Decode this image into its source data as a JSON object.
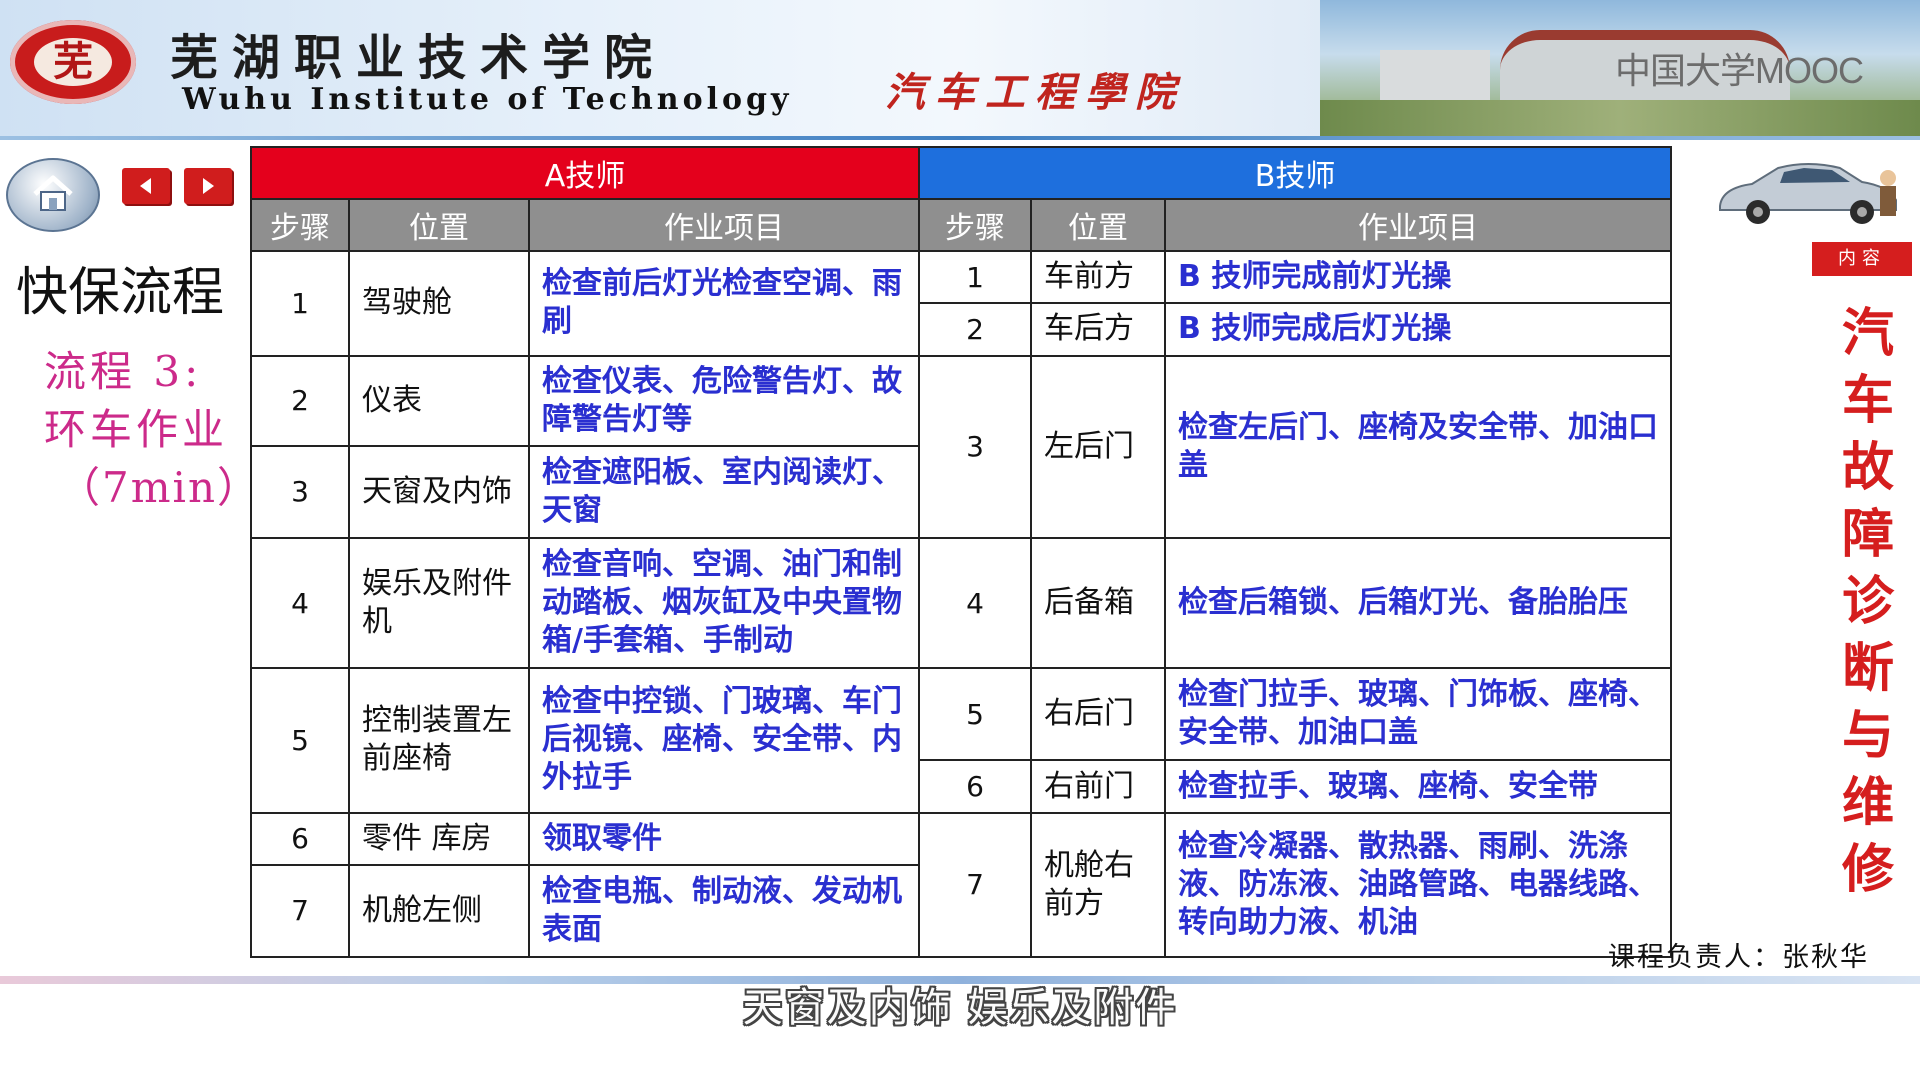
{
  "header": {
    "logo_text": "芜",
    "school_name_cn": "芜湖职业技术学院",
    "school_name_en": "Wuhu Institute of Technology",
    "college_name": "汽车工程學院",
    "watermark": "中国大学MOOC"
  },
  "left": {
    "title": "快保流程",
    "subtitle_line1": "流程 3:",
    "subtitle_line2": "环车作业",
    "subtitle_line3": "（7min）"
  },
  "table": {
    "header_a": "A技师",
    "header_b": "B技师",
    "col_step": "步骤",
    "col_position": "位置",
    "col_task": "作业项目",
    "a_rows": [
      {
        "step": "1",
        "position": "驾驶舱",
        "task": "检查前后灯光检查空调、雨刷"
      },
      {
        "step": "2",
        "position": "仪表",
        "task": "检查仪表、危险警告灯、故障警告灯等"
      },
      {
        "step": "3",
        "position": "天窗及内饰",
        "task": "检查遮阳板、室内阅读灯、天窗"
      },
      {
        "step": "4",
        "position": "娱乐及附件机",
        "task": "检查音响、空调、油门和制动踏板、烟灰缸及中央置物箱/手套箱、手制动"
      },
      {
        "step": "5",
        "position": "控制装置左前座椅",
        "task": "检查中控锁、门玻璃、车门后视镜、座椅、安全带、内外拉手"
      },
      {
        "step": "6",
        "position": "零件 库房",
        "task": "领取零件"
      },
      {
        "step": "7",
        "position": "机舱左侧",
        "task": "检查电瓶、制动液、发动机表面"
      }
    ],
    "b_rows": [
      {
        "step": "1",
        "position": "车前方",
        "task": "B 技师完成前灯光操"
      },
      {
        "step": "2",
        "position": "车后方",
        "task": "B 技师完成后灯光操"
      },
      {
        "step": "3",
        "position": "左后门",
        "task": "检查左后门、座椅及安全带、加油口盖"
      },
      {
        "step": "4",
        "position": "后备箱",
        "task": "检查后箱锁、后箱灯光、备胎胎压"
      },
      {
        "step": "5",
        "position": "右后门",
        "task": "检查门拉手、玻璃、门饰板、座椅、安全带、加油口盖"
      },
      {
        "step": "6",
        "position": "右前门",
        "task": "检查拉手、玻璃、座椅、安全带"
      },
      {
        "step": "7",
        "position": "机舱右前方",
        "task": "检查冷凝器、散热器、雨刷、洗涤液、防冻液、油路管路、电器线路、转向助力液、机油"
      }
    ]
  },
  "right": {
    "badge": "内容",
    "course_title": "汽车故障诊断与维修",
    "teacher": "课程负责人：张秋华"
  },
  "caption": "天窗及内饰 娱乐及附件",
  "colors": {
    "a_header": "#e4001c",
    "b_header": "#1e6fdd",
    "task_text": "#2a2fd0",
    "accent_red": "#d51e1e",
    "subtitle_pink": "#cc2a8a"
  },
  "icons": [
    "home-icon",
    "prev-arrow-icon",
    "next-arrow-icon",
    "car-icon"
  ]
}
